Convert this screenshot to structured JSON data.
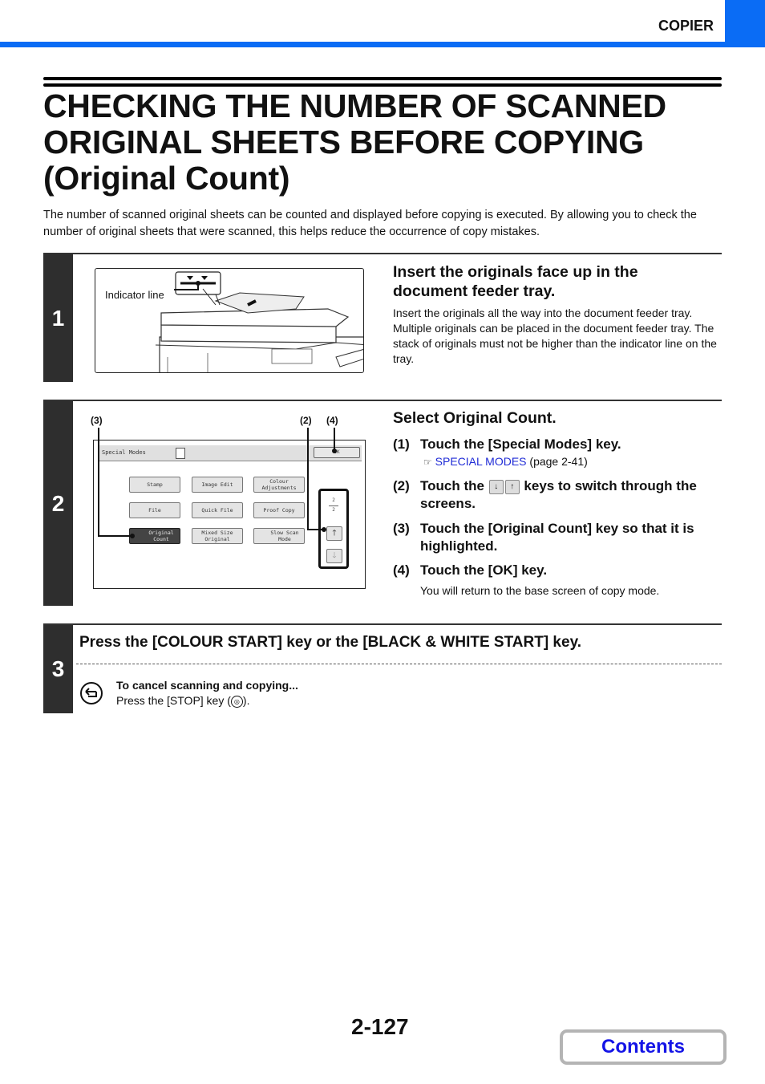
{
  "header": {
    "section": "COPIER",
    "accent_color": "#0a6cf5"
  },
  "title": "CHECKING THE NUMBER OF SCANNED ORIGINAL SHEETS BEFORE COPYING (Original Count)",
  "title_lines": [
    "CHECKING THE NUMBER OF SCANNED",
    "ORIGINAL SHEETS BEFORE COPYING",
    "(Original Count)"
  ],
  "intro": "The number of scanned original sheets can be counted and displayed before copying is executed. By allowing you to check the number of original sheets that were scanned, this helps reduce the occurrence of copy mistakes.",
  "steps": [
    {
      "number": "1",
      "heading": "Insert the originals face up in the document feeder tray.",
      "body": "Insert the originals all the way into the document feeder tray. Multiple originals can be placed in the document feeder tray. The stack of originals must not be higher than the indicator line on the tray.",
      "illustration": {
        "indicator_label": "Indicator line",
        "icon": "document-feeder-illustration"
      }
    },
    {
      "number": "2",
      "heading": "Select Original Count.",
      "screen": {
        "title": "Special Modes",
        "ok_label": "OK",
        "buttons": [
          "Stamp",
          "Image Edit",
          "Colour Adjustments",
          "File",
          "Quick File",
          "Proof Copy",
          "Original Count",
          "Mixed Size Original",
          "Slow Scan Mode"
        ],
        "selected": "Original Count",
        "page_current": "2",
        "page_total": "2",
        "callouts": [
          "(3)",
          "(2)",
          "(4)"
        ]
      },
      "substeps": [
        {
          "num": "(1)",
          "text": "Touch the [Special Modes] key.",
          "ref_link": "SPECIAL MODES",
          "ref_page": "(page 2-41)",
          "ref_icon": "pointing-hand-icon"
        },
        {
          "num": "(2)",
          "text_before": "Touch the",
          "text_after": "keys to switch through the screens."
        },
        {
          "num": "(3)",
          "text": "Touch the [Original Count] key so that it is highlighted."
        },
        {
          "num": "(4)",
          "text": "Touch the [OK] key.",
          "note": "You will return to the base screen of copy mode."
        }
      ]
    },
    {
      "number": "3",
      "heading": "Press the [COLOUR START] key or the [BLACK & WHITE START] key.",
      "note_title": "To cancel scanning and copying...",
      "note_text_before": "Press the [STOP] key (",
      "note_text_after": ")."
    }
  ],
  "footer": {
    "page_number": "2-127",
    "contents_label": "Contents",
    "contents_color": "#1414e6"
  }
}
